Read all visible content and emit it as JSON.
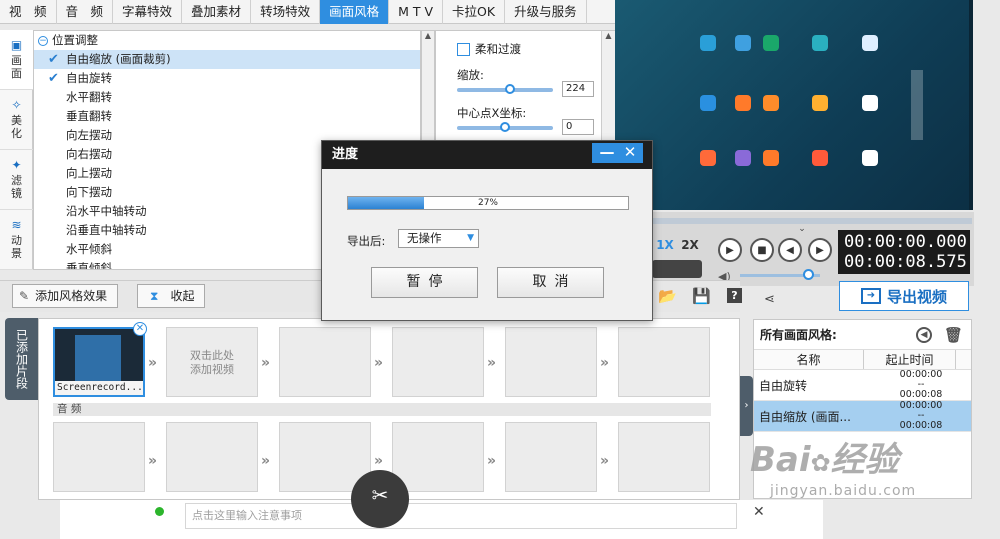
{
  "topbar": {
    "tabs": [
      "视　频",
      "音　频",
      "字幕特效",
      "叠加素材",
      "转场特效",
      "画面风格",
      "M T V",
      "卡拉OK",
      "升级与服务"
    ],
    "active_index": 5
  },
  "vtabs": [
    {
      "label": "画\n面",
      "icon": "picture-icon"
    },
    {
      "label": "美\n化",
      "icon": "magic-wand-icon"
    },
    {
      "label": "滤\n镜",
      "icon": "filter-icon"
    },
    {
      "label": "动\n景",
      "icon": "wave-icon"
    }
  ],
  "tree": {
    "root": "位置调整",
    "items": [
      {
        "label": "自由缩放 (画面裁剪)",
        "checked": true,
        "selected": true
      },
      {
        "label": "自由旋转",
        "checked": true,
        "selected": false
      },
      {
        "label": "水平翻转"
      },
      {
        "label": "垂直翻转"
      },
      {
        "label": "向左摆动"
      },
      {
        "label": "向右摆动"
      },
      {
        "label": "向上摆动"
      },
      {
        "label": "向下摆动"
      },
      {
        "label": "沿水平中轴转动"
      },
      {
        "label": "沿垂直中轴转动"
      },
      {
        "label": "水平倾斜"
      },
      {
        "label": "垂直倾斜"
      }
    ]
  },
  "props": {
    "soft_transition_label": "柔和过渡",
    "zoom_label": "缩放:",
    "zoom_value": "224",
    "zoom_level": 0.55,
    "center_x_label": "中心点X坐标:",
    "center_x_value": "0",
    "center_x_level": 0.5
  },
  "player": {
    "speed_1x": "1X",
    "speed_2x": "2X",
    "time_current": "00:00:00.000",
    "time_total": "00:00:08.575",
    "volume_level": 0.85
  },
  "toolbar": {
    "add_style_label": "添加风格效果",
    "collapse_label": "收起",
    "export_label": "导出视频"
  },
  "clips": {
    "panel_label": "已添加片段",
    "first_clip_name": "Screenrecord...",
    "add_hint_line1": "双击此处",
    "add_hint_line2": "添加视频",
    "audio_label": "音 频"
  },
  "stylelist": {
    "title": "所有画面风格:",
    "col_name": "名称",
    "col_time": "起止时间",
    "rows": [
      {
        "name": "自由旋转",
        "t1": "00:00:00",
        "t2": "--",
        "t3": "00:00:08",
        "selected": false
      },
      {
        "name": "自由缩放 (画面...",
        "t1": "00:00:00",
        "t2": "--",
        "t3": "00:00:08",
        "selected": true
      }
    ]
  },
  "dialog": {
    "title": "进度",
    "progress_text": "27%",
    "progress": 0.27,
    "after_export_label": "导出后:",
    "after_export_value": "无操作",
    "pause_label": "暂停",
    "cancel_label": "取消"
  },
  "note": {
    "placeholder": "点击这里输入注意事项"
  },
  "watermark": {
    "brand": "Bai",
    "brand_tail": "经验",
    "url": "jingyan.baidu.com"
  },
  "colors": {
    "accent": "#2f8ee0",
    "dark": "#1e1e1e",
    "selected_row": "#a5cff0"
  }
}
